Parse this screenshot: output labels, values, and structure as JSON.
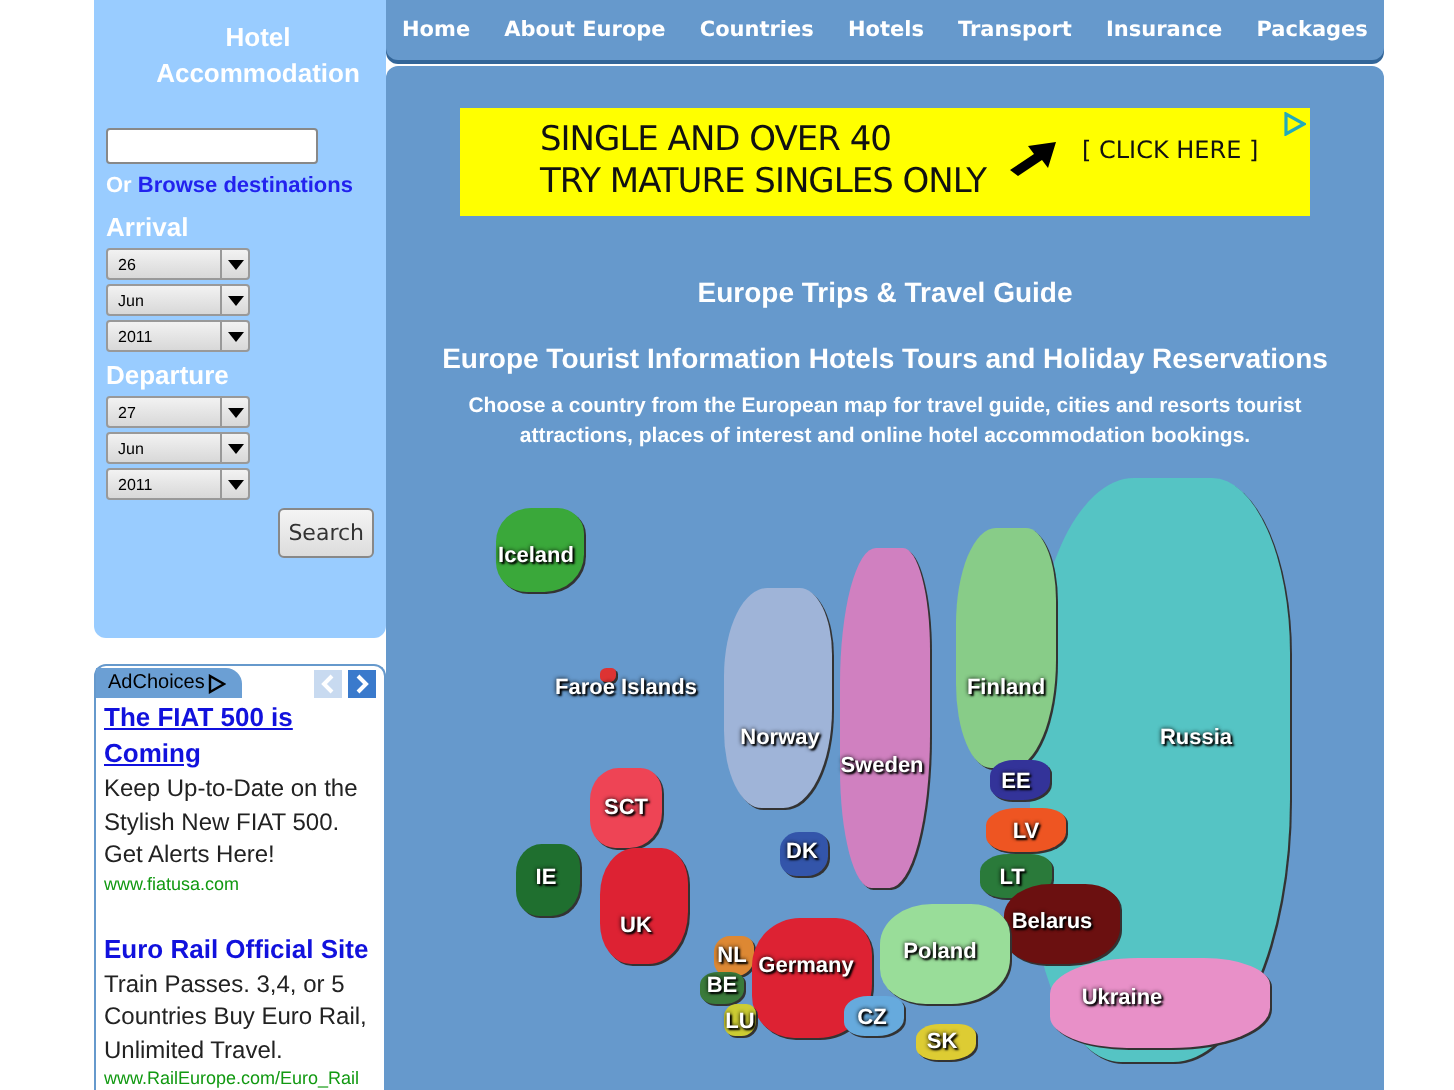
{
  "nav": [
    {
      "label": "Home"
    },
    {
      "label": "About Europe"
    },
    {
      "label": "Countries"
    },
    {
      "label": "Hotels"
    },
    {
      "label": "Transport"
    },
    {
      "label": "Insurance"
    },
    {
      "label": "Packages"
    }
  ],
  "hotel_panel": {
    "title": "Hotel Accommodation",
    "browse_prefix": "Or",
    "browse_link": "Browse destinations",
    "arrival": {
      "label": "Arrival",
      "day": "26",
      "month": "Jun",
      "year": "2011"
    },
    "departure": {
      "label": "Departure",
      "day": "27",
      "month": "Jun",
      "year": "2011"
    },
    "search_button": "Search"
  },
  "ad_box": {
    "header": "AdChoices",
    "ads": [
      {
        "title": "The FIAT 500 is Coming",
        "text": "Keep Up-to-Date on the Stylish New FIAT 500. Get Alerts Here!",
        "url": "www.fiatusa.com"
      },
      {
        "title": "Euro Rail Official Site",
        "text": "Train Passes. 3,4, or 5 Countries Buy Euro Rail, Unlimited Travel.",
        "url": "www.RailEurope.com/Euro_Rail"
      }
    ]
  },
  "banner": {
    "line_1": "SINGLE AND OVER 40",
    "line_2": "TRY MATURE SINGLES ONLY",
    "cta": "[ CLICK HERE ]"
  },
  "heading": "Europe Trips & Travel Guide",
  "subheading": "Europe Tourist Information Hotels Tours and Holiday Reservations",
  "intro": "Choose a country from the European map for travel guide, cities and resorts tourist attractions, places of interest and online hotel accommodation bookings.",
  "map": {
    "countries": [
      {
        "label": "Russia",
        "color": "#55c4c4"
      },
      {
        "label": "Iceland",
        "color": "#3aa83a"
      },
      {
        "label": "Faroe Islands",
        "color": "#dd3333"
      },
      {
        "label": "Norway",
        "color": "#9fb4d8"
      },
      {
        "label": "Sweden",
        "color": "#d080c0"
      },
      {
        "label": "Finland",
        "color": "#88cc88"
      },
      {
        "label": "EE",
        "color": "#333399"
      },
      {
        "label": "LV",
        "color": "#ee5522"
      },
      {
        "label": "SCT",
        "color": "#ee4455"
      },
      {
        "label": "DK",
        "color": "#3355aa"
      },
      {
        "label": "LT",
        "color": "#2a7a3a"
      },
      {
        "label": "IE",
        "color": "#1f6f2f"
      },
      {
        "label": "Belarus",
        "color": "#6b1010"
      },
      {
        "label": "UK",
        "color": "#dd2233"
      },
      {
        "label": "NL",
        "color": "#dd8833"
      },
      {
        "label": "Germany",
        "color": "#dd2233"
      },
      {
        "label": "Poland",
        "color": "#99dd99"
      },
      {
        "label": "BE",
        "color": "#3a7a3a"
      },
      {
        "label": "Ukraine",
        "color": "#e890c8"
      },
      {
        "label": "LU",
        "color": "#cccc33"
      },
      {
        "label": "CZ",
        "color": "#66aadd"
      },
      {
        "label": "SK",
        "color": "#ddcc33"
      }
    ]
  }
}
